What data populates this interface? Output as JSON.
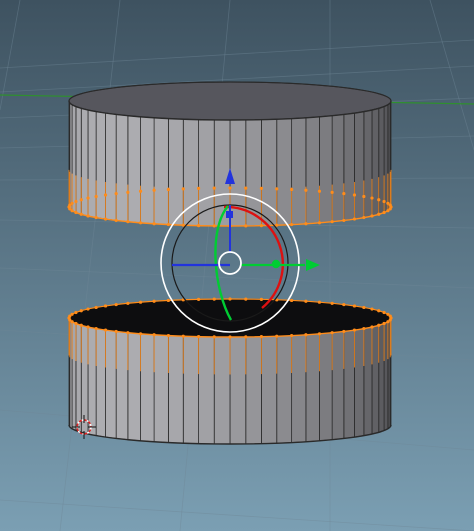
{
  "viewport": {
    "name": "3d-viewport",
    "background_top": "#3e5260",
    "background_bottom": "#7b9fb3",
    "grid_color": "#6f8797",
    "axis_line_color": "#2f8f2f"
  },
  "scene": {
    "objects": [
      {
        "name": "upper-cylinder-ring",
        "segments": 32,
        "hollow": true,
        "bottom_edge_selected": true
      },
      {
        "name": "lower-cylinder-ring",
        "segments": 32,
        "hollow": true,
        "top_edge_selected": true
      }
    ],
    "selection_color": "#ff8c1a",
    "wire_color": "#2a2a2a"
  },
  "gizmo": {
    "mode": "rotate",
    "x_axis_color": "#00cc33",
    "y_axis_color": "#2233dd",
    "z_axis_color": "#dd1111",
    "view_ring_color": "#ffffff"
  },
  "cursor_3d": {
    "icon": "3d-cursor-icon"
  }
}
